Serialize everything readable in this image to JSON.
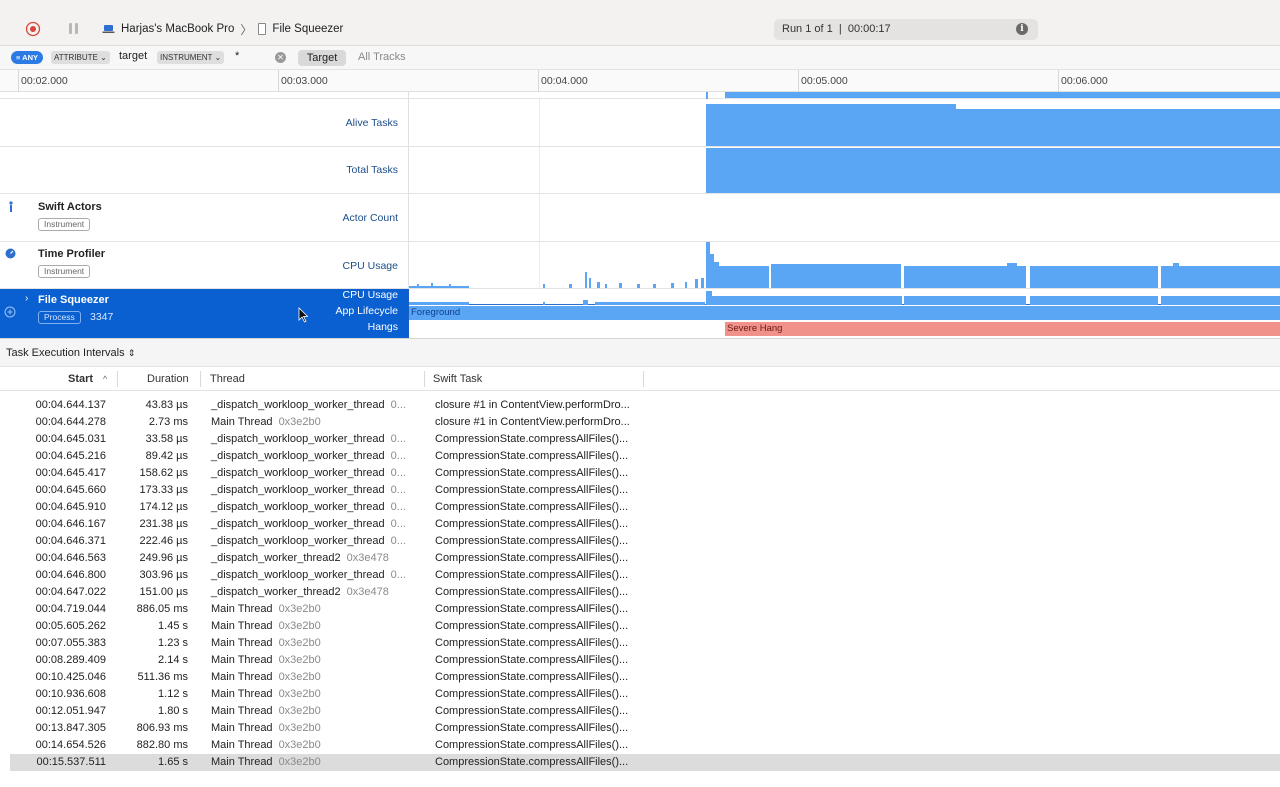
{
  "toolbar": {
    "device": "Harjas's MacBook Pro",
    "process": "File Squeezer",
    "run_info": "Run 1 of 1  |  00:00:17"
  },
  "filter": {
    "any_label": "ANY",
    "attribute_token": "ATTRIBUTE",
    "attribute_value": "target",
    "instrument_token": "INSTRUMENT",
    "instrument_value": "*",
    "tab_target": "Target",
    "tab_all_tracks": "All Tracks"
  },
  "ruler": {
    "ticks": [
      "00:02.000",
      "00:03.000",
      "00:04.000",
      "00:05.000",
      "00:06.000"
    ]
  },
  "tracks": {
    "alive_tasks": "Alive Tasks",
    "total_tasks": "Total Tasks",
    "swift_actors": {
      "name": "Swift Actors",
      "tag": "Instrument",
      "lane": "Actor Count"
    },
    "time_profiler": {
      "name": "Time Profiler",
      "tag": "Instrument",
      "lane": "CPU Usage"
    },
    "file_squeezer": {
      "name": "File Squeezer",
      "tag": "Process",
      "pid": "3347",
      "lanes": [
        "CPU Usage",
        "App Lifecycle",
        "Hangs"
      ],
      "lifecycle_state": "Foreground",
      "hang_label": "Severe Hang"
    },
    "colors": {
      "graph": "#5aa6f4",
      "hang": "#f0918a",
      "selection": "#0a5fd1"
    }
  },
  "detail": {
    "selector": "Task Execution Intervals",
    "columns": {
      "start": "Start",
      "duration": "Duration",
      "thread": "Thread",
      "task": "Swift Task"
    },
    "rows": [
      {
        "start": "00:04.644.137",
        "duration": "43.83 µs",
        "thread": "_dispatch_workloop_worker_thread",
        "tid": "0...",
        "task": "closure #1 in ContentView.performDro..."
      },
      {
        "start": "00:04.644.278",
        "duration": "2.73 ms",
        "thread": "Main Thread",
        "tid": "0x3e2b0",
        "task": "closure #1 in ContentView.performDro..."
      },
      {
        "start": "00:04.645.031",
        "duration": "33.58 µs",
        "thread": "_dispatch_workloop_worker_thread",
        "tid": "0...",
        "task": "CompressionState.compressAllFiles()..."
      },
      {
        "start": "00:04.645.216",
        "duration": "89.42 µs",
        "thread": "_dispatch_workloop_worker_thread",
        "tid": "0...",
        "task": "CompressionState.compressAllFiles()..."
      },
      {
        "start": "00:04.645.417",
        "duration": "158.62 µs",
        "thread": "_dispatch_workloop_worker_thread",
        "tid": "0...",
        "task": "CompressionState.compressAllFiles()..."
      },
      {
        "start": "00:04.645.660",
        "duration": "173.33 µs",
        "thread": "_dispatch_workloop_worker_thread",
        "tid": "0...",
        "task": "CompressionState.compressAllFiles()..."
      },
      {
        "start": "00:04.645.910",
        "duration": "174.12 µs",
        "thread": "_dispatch_workloop_worker_thread",
        "tid": "0...",
        "task": "CompressionState.compressAllFiles()..."
      },
      {
        "start": "00:04.646.167",
        "duration": "231.38 µs",
        "thread": "_dispatch_workloop_worker_thread",
        "tid": "0...",
        "task": "CompressionState.compressAllFiles()..."
      },
      {
        "start": "00:04.646.371",
        "duration": "222.46 µs",
        "thread": "_dispatch_workloop_worker_thread",
        "tid": "0...",
        "task": "CompressionState.compressAllFiles()..."
      },
      {
        "start": "00:04.646.563",
        "duration": "249.96 µs",
        "thread": "_dispatch_worker_thread2",
        "tid": "0x3e478",
        "task": "CompressionState.compressAllFiles()..."
      },
      {
        "start": "00:04.646.800",
        "duration": "303.96 µs",
        "thread": "_dispatch_workloop_worker_thread",
        "tid": "0...",
        "task": "CompressionState.compressAllFiles()..."
      },
      {
        "start": "00:04.647.022",
        "duration": "151.00 µs",
        "thread": "_dispatch_worker_thread2",
        "tid": "0x3e478",
        "task": "CompressionState.compressAllFiles()..."
      },
      {
        "start": "00:04.719.044",
        "duration": "886.05 ms",
        "thread": "Main Thread",
        "tid": "0x3e2b0",
        "task": "CompressionState.compressAllFiles()..."
      },
      {
        "start": "00:05.605.262",
        "duration": "1.45 s",
        "thread": "Main Thread",
        "tid": "0x3e2b0",
        "task": "CompressionState.compressAllFiles()..."
      },
      {
        "start": "00:07.055.383",
        "duration": "1.23 s",
        "thread": "Main Thread",
        "tid": "0x3e2b0",
        "task": "CompressionState.compressAllFiles()..."
      },
      {
        "start": "00:08.289.409",
        "duration": "2.14 s",
        "thread": "Main Thread",
        "tid": "0x3e2b0",
        "task": "CompressionState.compressAllFiles()..."
      },
      {
        "start": "00:10.425.046",
        "duration": "511.36 ms",
        "thread": "Main Thread",
        "tid": "0x3e2b0",
        "task": "CompressionState.compressAllFiles()..."
      },
      {
        "start": "00:10.936.608",
        "duration": "1.12 s",
        "thread": "Main Thread",
        "tid": "0x3e2b0",
        "task": "CompressionState.compressAllFiles()..."
      },
      {
        "start": "00:12.051.947",
        "duration": "1.80 s",
        "thread": "Main Thread",
        "tid": "0x3e2b0",
        "task": "CompressionState.compressAllFiles()..."
      },
      {
        "start": "00:13.847.305",
        "duration": "806.93 ms",
        "thread": "Main Thread",
        "tid": "0x3e2b0",
        "task": "CompressionState.compressAllFiles()..."
      },
      {
        "start": "00:14.654.526",
        "duration": "882.80 ms",
        "thread": "Main Thread",
        "tid": "0x3e2b0",
        "task": "CompressionState.compressAllFiles()..."
      },
      {
        "start": "00:15.537.511",
        "duration": "1.65 s",
        "thread": "Main Thread",
        "tid": "0x3e2b0",
        "task": "CompressionState.compressAllFiles()..."
      }
    ]
  }
}
